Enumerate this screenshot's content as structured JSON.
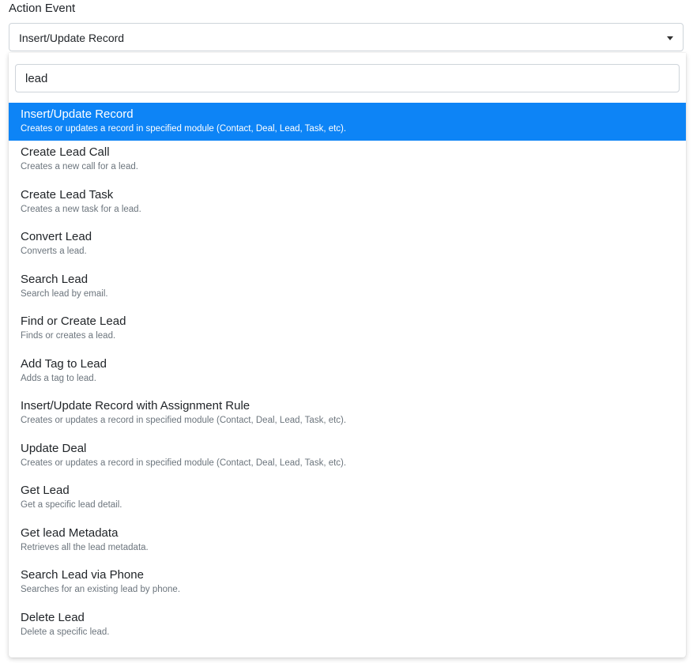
{
  "field": {
    "label": "Action Event",
    "selected_value": "Insert/Update Record"
  },
  "search": {
    "value": "lead",
    "placeholder": ""
  },
  "colors": {
    "selected_bg": "#0d84f6",
    "selected_text": "#ffffff",
    "description_text": "#6c757d"
  },
  "options": [
    {
      "title": "Insert/Update Record",
      "description": "Creates or updates a record in specified module (Contact, Deal, Lead, Task, etc).",
      "selected": true
    },
    {
      "title": "Create Lead Call",
      "description": "Creates a new call for a lead."
    },
    {
      "title": "Create Lead Task",
      "description": "Creates a new task for a lead."
    },
    {
      "title": "Convert Lead",
      "description": "Converts a lead."
    },
    {
      "title": "Search Lead",
      "description": "Search lead by email."
    },
    {
      "title": "Find or Create Lead",
      "description": "Finds or creates a lead."
    },
    {
      "title": "Add Tag to Lead",
      "description": "Adds a tag to lead."
    },
    {
      "title": "Insert/Update Record with Assignment Rule",
      "description": "Creates or updates a record in specified module (Contact, Deal, Lead, Task, etc)."
    },
    {
      "title": "Update Deal",
      "description": "Creates or updates a record in specified module (Contact, Deal, Lead, Task, etc)."
    },
    {
      "title": "Get Lead",
      "description": "Get a specific lead detail."
    },
    {
      "title": "Get lead Metadata",
      "description": "Retrieves all the lead metadata."
    },
    {
      "title": "Search Lead via Phone",
      "description": "Searches for an existing lead by phone."
    },
    {
      "title": "Delete Lead",
      "description": "Delete a specific lead."
    }
  ]
}
